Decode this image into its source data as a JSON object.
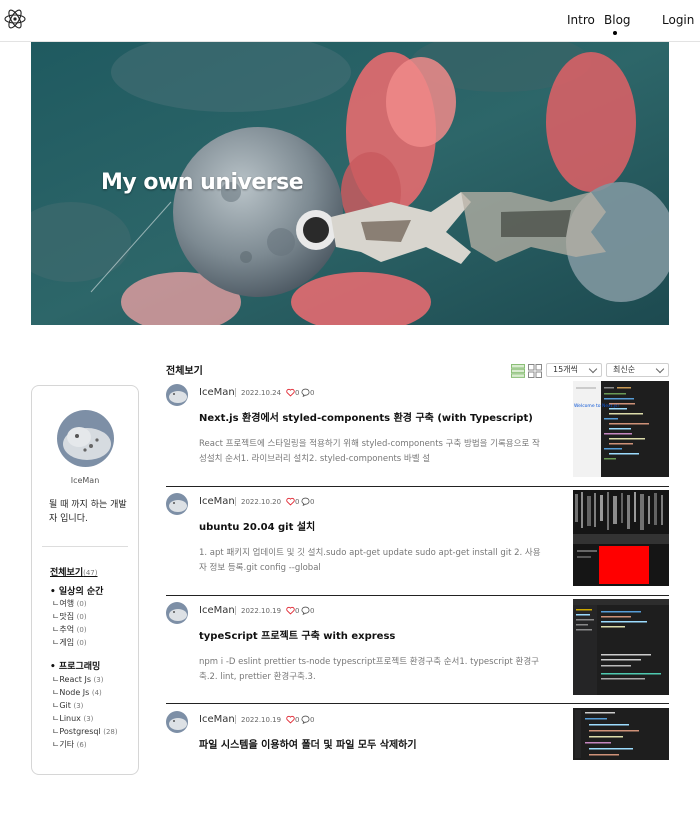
{
  "nav": {
    "intro": "Intro",
    "blog": "Blog",
    "login": "Login"
  },
  "hero": {
    "title": "My own universe"
  },
  "profile": {
    "name": "IceMan",
    "bio": "될 때 까지 하는 개발자 입니다."
  },
  "categories": {
    "all_label": "전체보기",
    "all_count": "(47)",
    "groups": [
      {
        "label": "• 일상의 순간",
        "items": [
          {
            "label": "ㄴ여행",
            "count": "(0)"
          },
          {
            "label": "ㄴ맛집",
            "count": "(0)"
          },
          {
            "label": "ㄴ추억",
            "count": "(0)"
          },
          {
            "label": "ㄴ게임",
            "count": "(0)"
          }
        ]
      },
      {
        "label": "• 프로그래밍",
        "items": [
          {
            "label": "ㄴReact Js",
            "count": "(3)"
          },
          {
            "label": "ㄴNode Js",
            "count": "(4)"
          },
          {
            "label": "ㄴGit",
            "count": "(3)"
          },
          {
            "label": "ㄴLinux",
            "count": "(3)"
          },
          {
            "label": "ㄴPostgresql",
            "count": "(28)"
          },
          {
            "label": "ㄴ기타",
            "count": "(6)"
          }
        ]
      }
    ]
  },
  "list": {
    "title": "전체보기",
    "page_size": "15개씩",
    "sort": "최신순"
  },
  "posts": [
    {
      "author": "IceMan",
      "date": "2022.10.24",
      "likes": "0",
      "comments": "0",
      "title": "Next.js 환경에서 styled-components 환경 구축 (with Typescript)",
      "excerpt": "React 프로젝트에 스타일링을 적용하기 위해 styled-components 구축 방법을 기록용으로 작성설치 순서1. 라이브러리 설치2. styled-components 바벨 설"
    },
    {
      "author": "IceMan",
      "date": "2022.10.20",
      "likes": "0",
      "comments": "0",
      "title": "ubuntu 20.04 git 설치",
      "excerpt": "1. apt 패키지 업데이트 및 깃 설치.sudo apt-get update sudo apt-get install git 2. 사용자 정보 등록.git config --global"
    },
    {
      "author": "IceMan",
      "date": "2022.10.19",
      "likes": "0",
      "comments": "0",
      "title": "typeScript 프로젝트 구축 with express",
      "excerpt": "npm i -D eslint prettier ts-node typescript프로젝트 환경구축 순서1. typescript 환경구축.2. lint, prettier 환경구축.3."
    },
    {
      "author": "IceMan",
      "date": "2022.10.19",
      "likes": "0",
      "comments": "0",
      "title": "파일 시스템을 이용하여 폴더 및 파일 모두 삭제하기",
      "excerpt": ""
    }
  ],
  "thumb1": {
    "caption": "Welcome to Next.js!"
  },
  "colors": {
    "accent": "#e0242f",
    "hero_teal": "#2c5d63",
    "thumb_bg": "#1e1e1e"
  }
}
